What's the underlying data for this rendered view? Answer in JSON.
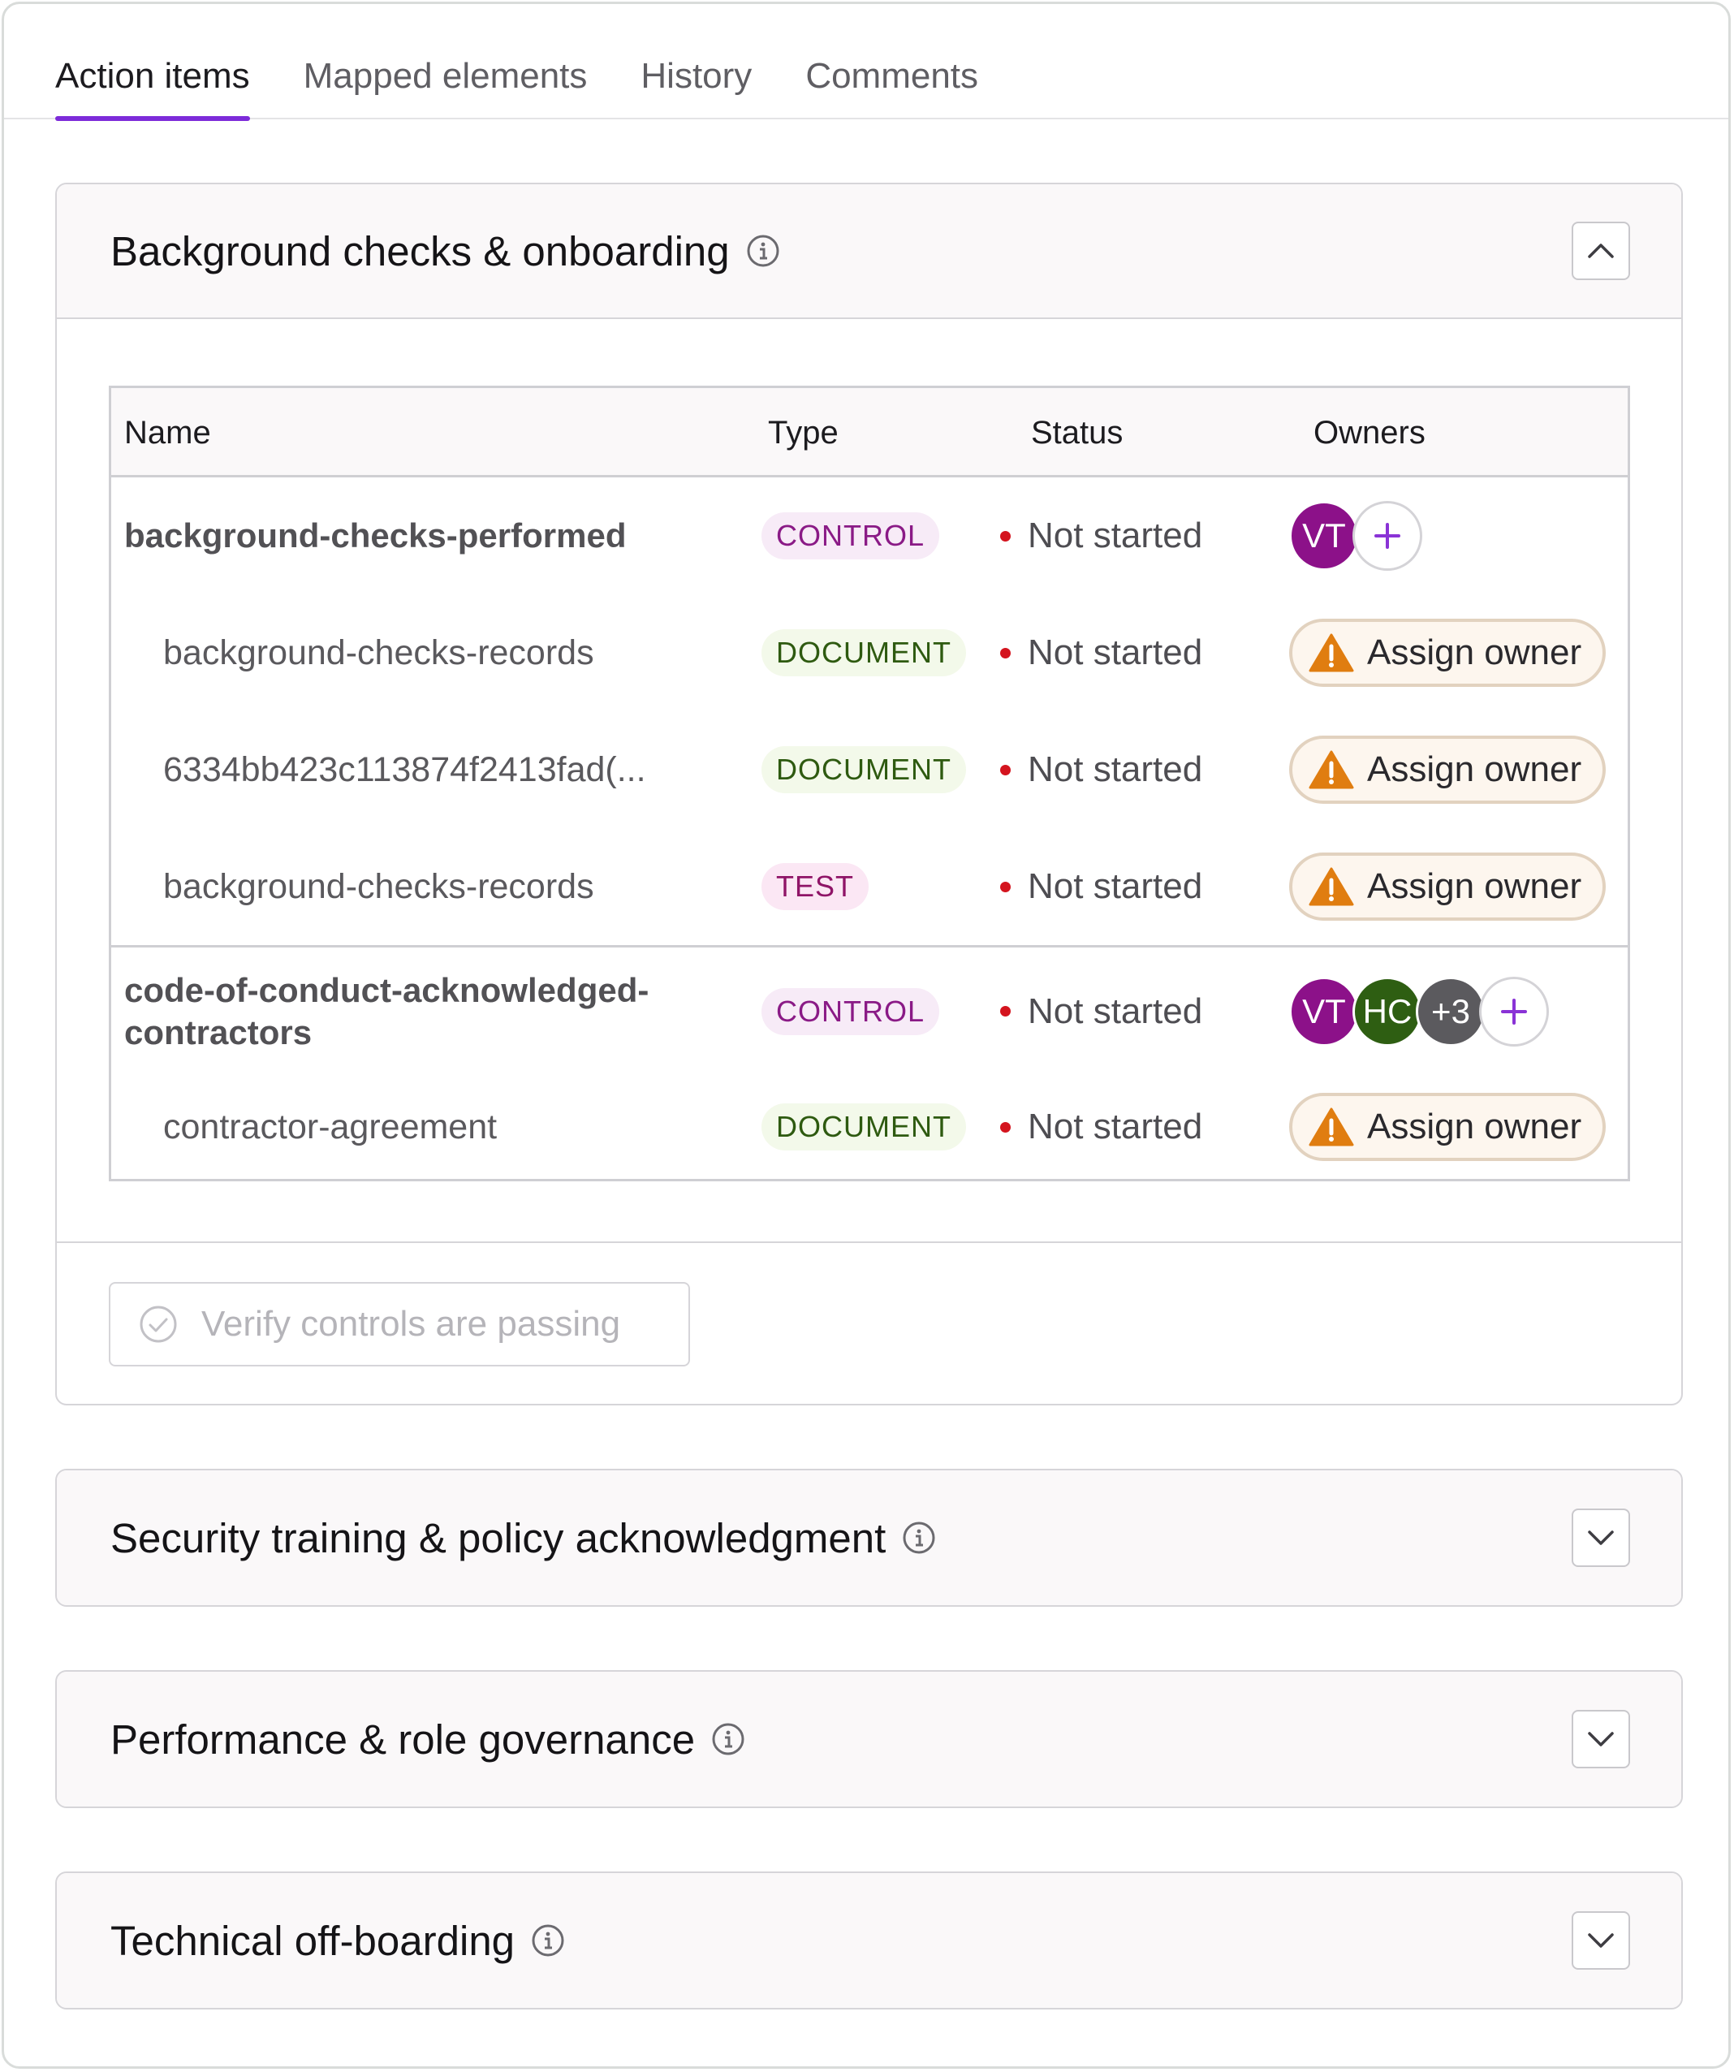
{
  "tabs": [
    {
      "label": "Action items",
      "active": true
    },
    {
      "label": "Mapped elements",
      "active": false
    },
    {
      "label": "History",
      "active": false
    },
    {
      "label": "Comments",
      "active": false
    }
  ],
  "sections": [
    {
      "title": "Background checks & onboarding",
      "expanded": true,
      "table": {
        "columns": [
          "Name",
          "Type",
          "Status",
          "Owners"
        ],
        "rows": [
          {
            "name": "background-checks-performed",
            "type": "CONTROL",
            "status": "Not started",
            "owners": [
              "VT"
            ]
          },
          {
            "name": "background-checks-records",
            "type": "DOCUMENT",
            "status": "Not started",
            "assign": "Assign owner"
          },
          {
            "name": "6334bb423c113874f2413fad(...",
            "type": "DOCUMENT",
            "status": "Not started",
            "assign": "Assign owner"
          },
          {
            "name": "background-checks-records",
            "type": "TEST",
            "status": "Not started",
            "assign": "Assign owner"
          },
          {
            "name": "code-of-conduct-acknowledged-contractors",
            "name_line1": "code-of-conduct-acknowledged-",
            "name_line2": "contractors",
            "type": "CONTROL",
            "status": "Not started",
            "owners": [
              "VT",
              "HC",
              "+3"
            ]
          },
          {
            "name": "contractor-agreement",
            "type": "DOCUMENT",
            "status": "Not started",
            "assign": "Assign owner"
          }
        ]
      },
      "footer_button": "Verify controls are passing"
    },
    {
      "title": "Security training & policy acknowledgment",
      "expanded": false
    },
    {
      "title": "Performance & role governance",
      "expanded": false
    },
    {
      "title": "Technical off-boarding",
      "expanded": false
    }
  ],
  "icons": {
    "info": "info-circle-icon",
    "chevron_up": "chevron-up-icon",
    "chevron_down": "chevron-down-icon",
    "warning": "warning-triangle-icon",
    "plus": "plus-icon",
    "check_circle": "check-circle-icon"
  },
  "colors": {
    "accent": "#7d2bd9",
    "status_dot": "#d4141e",
    "control_badge": "#8a1a86",
    "document_badge": "#2e5a10",
    "test_badge": "#8f1467",
    "warning": "#e07d10"
  }
}
